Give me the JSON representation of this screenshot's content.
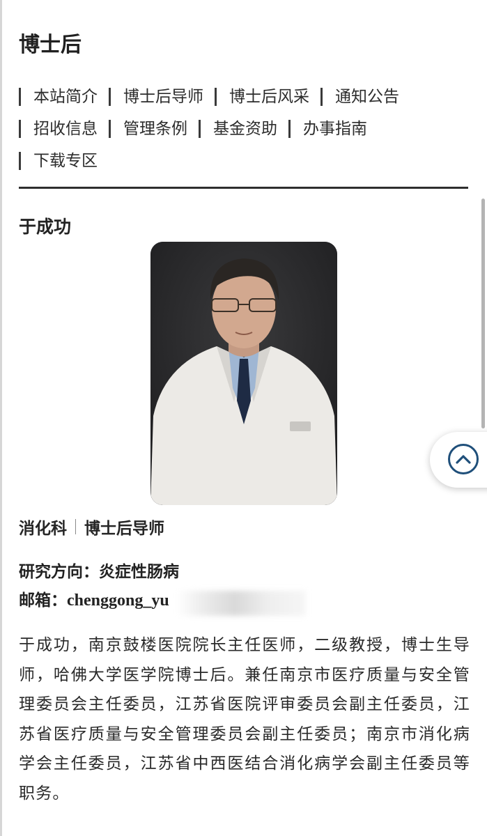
{
  "page_title": "博士后",
  "nav": {
    "rows": [
      [
        "本站简介",
        "博士后导师",
        "博士后风采",
        "通知公告"
      ],
      [
        "招收信息",
        "管理条例",
        "基金资助",
        "办事指南"
      ],
      [
        "下载专区"
      ]
    ]
  },
  "profile": {
    "name": "于成功",
    "photo_icon": "portrait-photo",
    "department": "消化科",
    "role": "博士后导师",
    "research_label": "研究方向：",
    "research_value": "炎症性肠病",
    "email_label": "邮箱：",
    "email_value": "chenggong_yu",
    "bio": "于成功，南京鼓楼医院院长主任医师，二级教授，博士生导师，哈佛大学医学院博士后。兼任南京市医疗质量与安全管理委员会主任委员，江苏省医院评审委员会副主任委员，江苏省医疗质量与安全管理委员会副主任委员；南京市消化病学会主任委员，江苏省中西医结合消化病学会副主任委员等职务。"
  },
  "back_to_top": {
    "icon": "chevron-up-icon"
  },
  "colors": {
    "accent": "#1f4f7a",
    "text": "#262626",
    "divider": "#2e2e2e"
  }
}
